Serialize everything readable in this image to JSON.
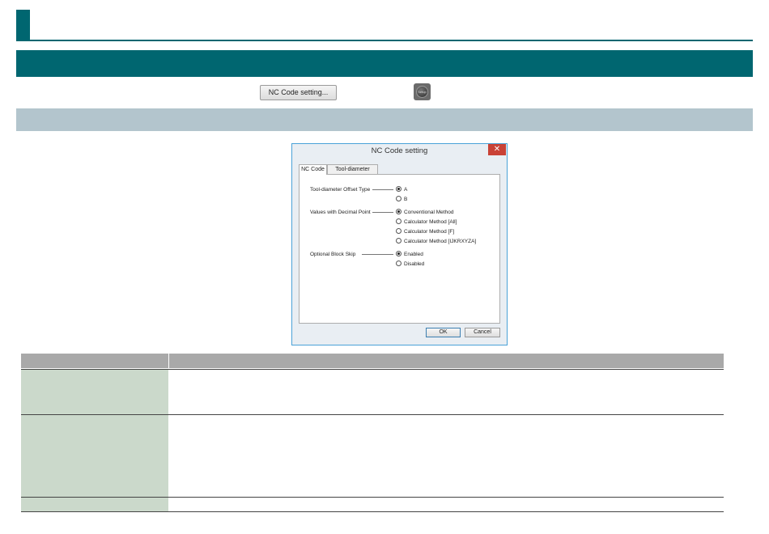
{
  "toolbar": {
    "nc_code_button_label": "NC Code setting..."
  },
  "dialog": {
    "title": "NC Code setting",
    "close_glyph": "✕",
    "tabs": [
      "NC Code",
      "Tool-diameter Offset"
    ],
    "groups": [
      {
        "label": "Tool-diameter Offset Type",
        "options": [
          {
            "label": "A",
            "selected": true
          },
          {
            "label": "B",
            "selected": false
          }
        ]
      },
      {
        "label": "Values with Decimal Point",
        "options": [
          {
            "label": "Conventional Method",
            "selected": true
          },
          {
            "label": "Calculator Method [All]",
            "selected": false
          },
          {
            "label": "Calculator Method [F]",
            "selected": false
          },
          {
            "label": "Calculator Method [IJKRXYZA]",
            "selected": false
          }
        ]
      },
      {
        "label": "Optional Block Skip",
        "options": [
          {
            "label": "Enabled",
            "selected": true
          },
          {
            "label": "Disabled",
            "selected": false
          }
        ]
      }
    ],
    "ok_label": "OK",
    "cancel_label": "Cancel"
  },
  "icons": {
    "round_button_icon": "round-dark-button-icon",
    "round_button_caption": "Setup"
  },
  "colors": {
    "teal": "#006670",
    "grey_band": "#b3c5cd",
    "table_header": "#a9a9a9",
    "table_left_cell": "#cbd9cb",
    "close_red": "#c94236"
  }
}
